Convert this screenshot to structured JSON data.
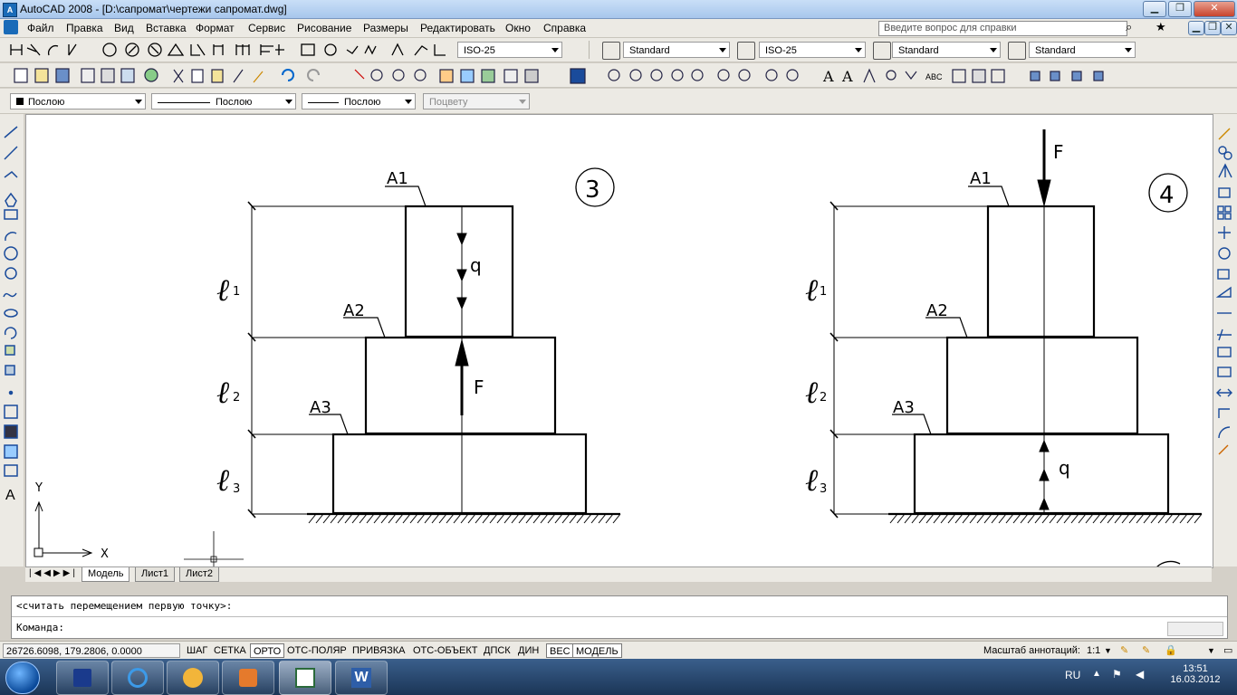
{
  "window": {
    "title": "AutoCAD 2008 - [D:\\сапромат\\чертежи сапромат.dwg]",
    "app_icon_label": "A"
  },
  "menu": {
    "items": [
      "Файл",
      "Правка",
      "Вид",
      "Вставка",
      "Формат",
      "Сервис",
      "Рисование",
      "Размеры",
      "Редактировать",
      "Окно",
      "Справка"
    ],
    "help_placeholder": "Введите вопрос для справки"
  },
  "toolbar1": {
    "dim_style": "ISO-25",
    "text_style": "Standard",
    "dim_style2": "ISO-25",
    "table_style": "Standard",
    "multileader_style": "Standard"
  },
  "properties": {
    "color": "Послою",
    "linetype": "Послою",
    "lineweight": "Послою",
    "plotstyle": "Поцвету"
  },
  "drawing": {
    "fig3": {
      "number": "3",
      "A1": "A1",
      "A2": "A2",
      "A3": "A3",
      "q": "q",
      "F": "F",
      "l1": "1",
      "l2": "2",
      "l3": "3"
    },
    "fig4": {
      "number": "4",
      "A1": "A1",
      "A2": "A2",
      "A3": "A3",
      "q": "q",
      "F": "F",
      "l1": "1",
      "l2": "2",
      "l3": "3"
    },
    "ucs": {
      "x": "X",
      "y": "Y"
    }
  },
  "tabs": [
    "Модель",
    "Лист1",
    "Лист2"
  ],
  "command": {
    "history": "<считать перемещением первую точку>:",
    "prompt": "Команда:"
  },
  "status": {
    "coords": "26726.6098, 179.2806, 0.0000",
    "buttons": [
      {
        "label": "ШАГ",
        "on": false
      },
      {
        "label": "СЕТКА",
        "on": false
      },
      {
        "label": "ОРТО",
        "on": true
      },
      {
        "label": "ОТС-ПОЛЯР",
        "on": false
      },
      {
        "label": "ПРИВЯЗКА",
        "on": false
      },
      {
        "label": "ОТС-ОБЪЕКТ",
        "on": false
      },
      {
        "label": "ДПСК",
        "on": false
      },
      {
        "label": "ДИН",
        "on": false
      },
      {
        "label": "ВЕС",
        "on": true
      },
      {
        "label": "МОДЕЛЬ",
        "on": true
      }
    ],
    "annotation_scale_label": "Масштаб аннотаций:",
    "annotation_scale": "1:1"
  },
  "taskbar": {
    "lang": "RU",
    "time": "13:51",
    "date": "16.03.2012"
  },
  "colors": {
    "titlebar": "#b8d1f0",
    "taskbar": "#2a4a72",
    "drawing_bg": "#ffffff"
  }
}
